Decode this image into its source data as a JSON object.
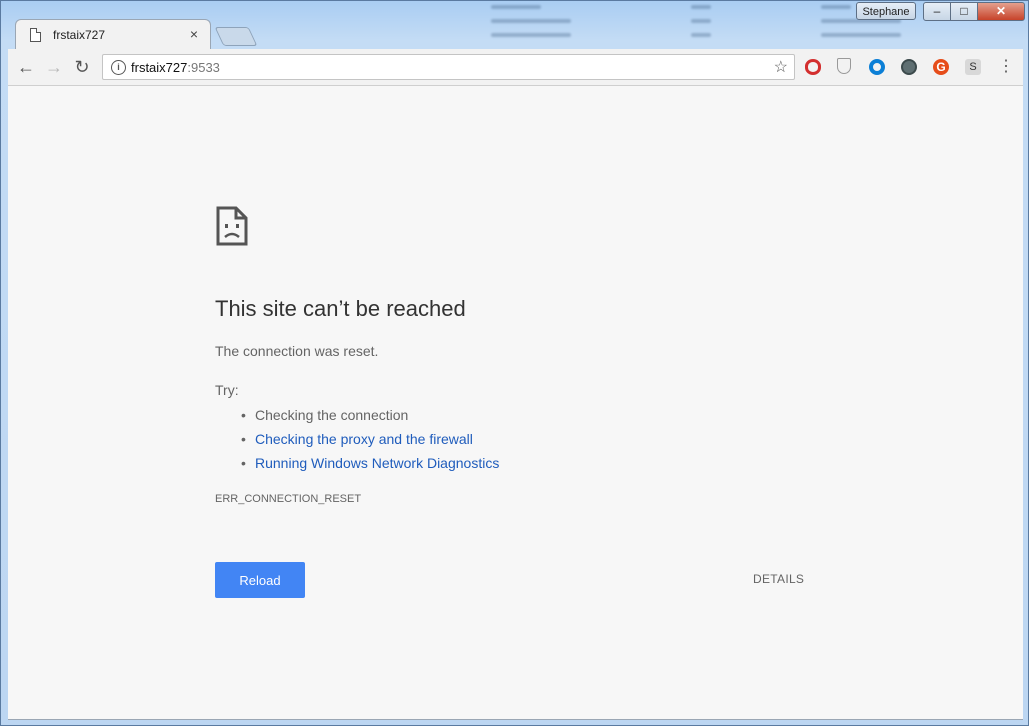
{
  "window": {
    "profile_name": "Stephane",
    "controls": {
      "minimize": "–",
      "maximize": "□",
      "close": "✕"
    }
  },
  "tab": {
    "title": "frstaix727",
    "close_symbol": "×",
    "icon": "page-icon"
  },
  "toolbar": {
    "back_symbol": "←",
    "forward_symbol": "→",
    "reload_symbol": "↻",
    "url_host": "frstaix727",
    "url_port": ":9533",
    "info_symbol": "i",
    "bookmark_symbol": "☆",
    "menu_symbol": "⋮",
    "extensions": [
      {
        "name": "opera-icon",
        "color": "#d32f2f"
      },
      {
        "name": "shield-icon",
        "color": "#999999"
      },
      {
        "name": "ring-icon",
        "color": "#0c7fd6"
      },
      {
        "name": "globe-icon",
        "color": "#5f6f72"
      },
      {
        "name": "grammarly-icon",
        "label": "G",
        "color": "#e64d1a"
      },
      {
        "name": "s-extension-icon",
        "label": "S",
        "color": "#d8d8d8"
      }
    ]
  },
  "error_page": {
    "icon": "sad-page-icon",
    "headline": "This site can’t be reached",
    "description": "The connection was reset.",
    "try_label": "Try:",
    "suggestions": [
      {
        "text": "Checking the connection",
        "link": false
      },
      {
        "text": "Checking the proxy and the firewall",
        "link": true
      },
      {
        "text": "Running Windows Network Diagnostics",
        "link": true
      }
    ],
    "error_code": "ERR_CONNECTION_RESET",
    "reload_label": "Reload",
    "details_label": "DETAILS",
    "colors": {
      "button": "#4285f4",
      "link": "#1f5cbc",
      "text": "#646464"
    }
  }
}
